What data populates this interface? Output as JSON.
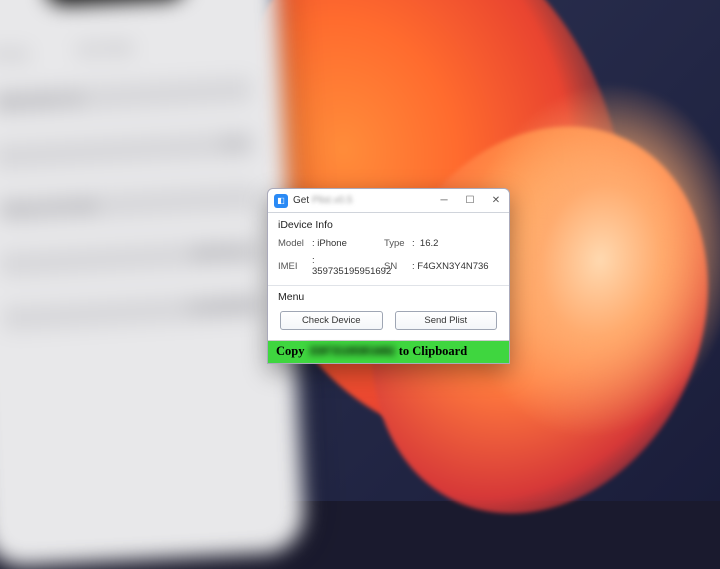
{
  "wallpaper": {},
  "phone": {
    "header_items": [
      "Chung",
      "Giới thiệu"
    ],
    "rows": [
      {
        "left": "Redmi Note 4 (1)",
        "right": ""
      },
      {
        "left": "",
        "right": "9.2.1"
      },
      {
        "left": "iPhone 12 Pro Max",
        "right": ""
      },
      {
        "left": "",
        "right": "MGTK3LL/A"
      },
      {
        "left": "",
        "right": "FLVJ0G0H0P"
      }
    ]
  },
  "window": {
    "title_prefix": "Get",
    "title_rest": "Plist.v0.5",
    "section_device": "iDevice Info",
    "fields": {
      "model_label": "Model",
      "model_value": "iPhone",
      "type_label": "Type",
      "type_value": "16.2",
      "imei_label": "IMEI",
      "imei_prefix": "359735",
      "imei_hidden": "195951692",
      "sn_label": "SN",
      "sn_hidden": "F4GXN3Y4N736"
    },
    "section_menu": "Menu",
    "buttons": {
      "check": "Check Device",
      "send": "Send Plist"
    },
    "status": {
      "prefix": "Copy",
      "value": "359735195951692",
      "suffix": "to Clipboard"
    }
  }
}
